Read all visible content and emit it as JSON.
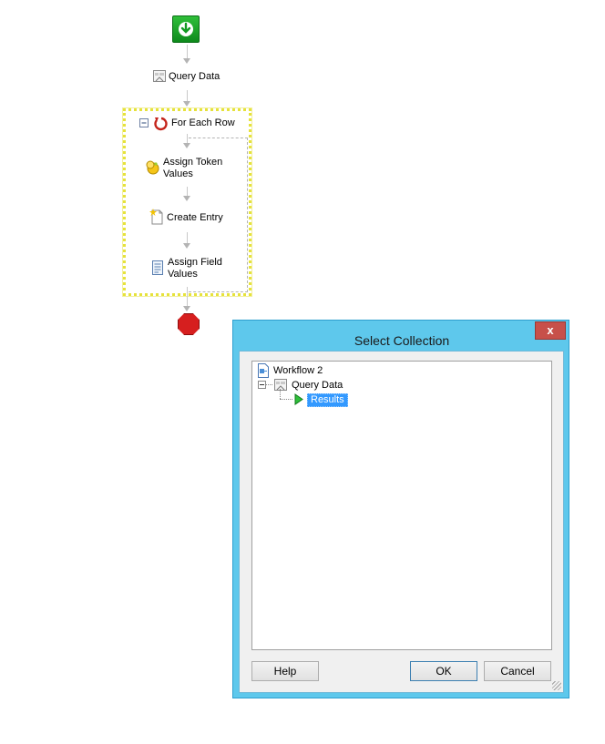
{
  "workflow": {
    "nodes": {
      "query_data": "Query Data",
      "for_each_row": "For Each Row",
      "assign_token_values_line1": "Assign Token",
      "assign_token_values_line2": "Values",
      "create_entry": "Create Entry",
      "assign_field_values_line1": "Assign Field",
      "assign_field_values_line2": "Values"
    }
  },
  "dialog": {
    "title": "Select Collection",
    "close_label": "x",
    "tree": {
      "root": "Workflow 2",
      "child": "Query Data",
      "leaf": "Results"
    },
    "buttons": {
      "help": "Help",
      "ok": "OK",
      "cancel": "Cancel"
    }
  },
  "colors": {
    "dialog_frame": "#5ec8ec",
    "selection": "#3399ff",
    "start": "#1aa32a",
    "stop": "#d61f1f",
    "container_border": "#e6e23c"
  }
}
